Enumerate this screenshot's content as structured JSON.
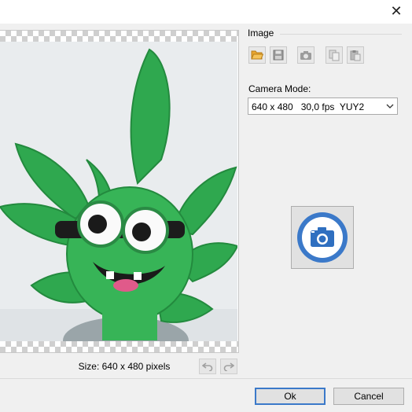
{
  "window": {
    "close_glyph": "✕"
  },
  "preview": {
    "size_label": "Size: 640 x 480 pixels"
  },
  "image_group": {
    "title": "Image"
  },
  "toolbar": {
    "icons": [
      "folder-open-icon",
      "save-icon",
      "camera-icon",
      "copy-icon",
      "paste-icon"
    ]
  },
  "camera": {
    "label": "Camera Mode:",
    "selected": "640 x 480   30,0 fps  YUY2"
  },
  "dialog": {
    "ok_label": "Ok",
    "cancel_label": "Cancel"
  },
  "colors": {
    "accent": "#3b79c9",
    "plush_green": "#2fa84f"
  }
}
